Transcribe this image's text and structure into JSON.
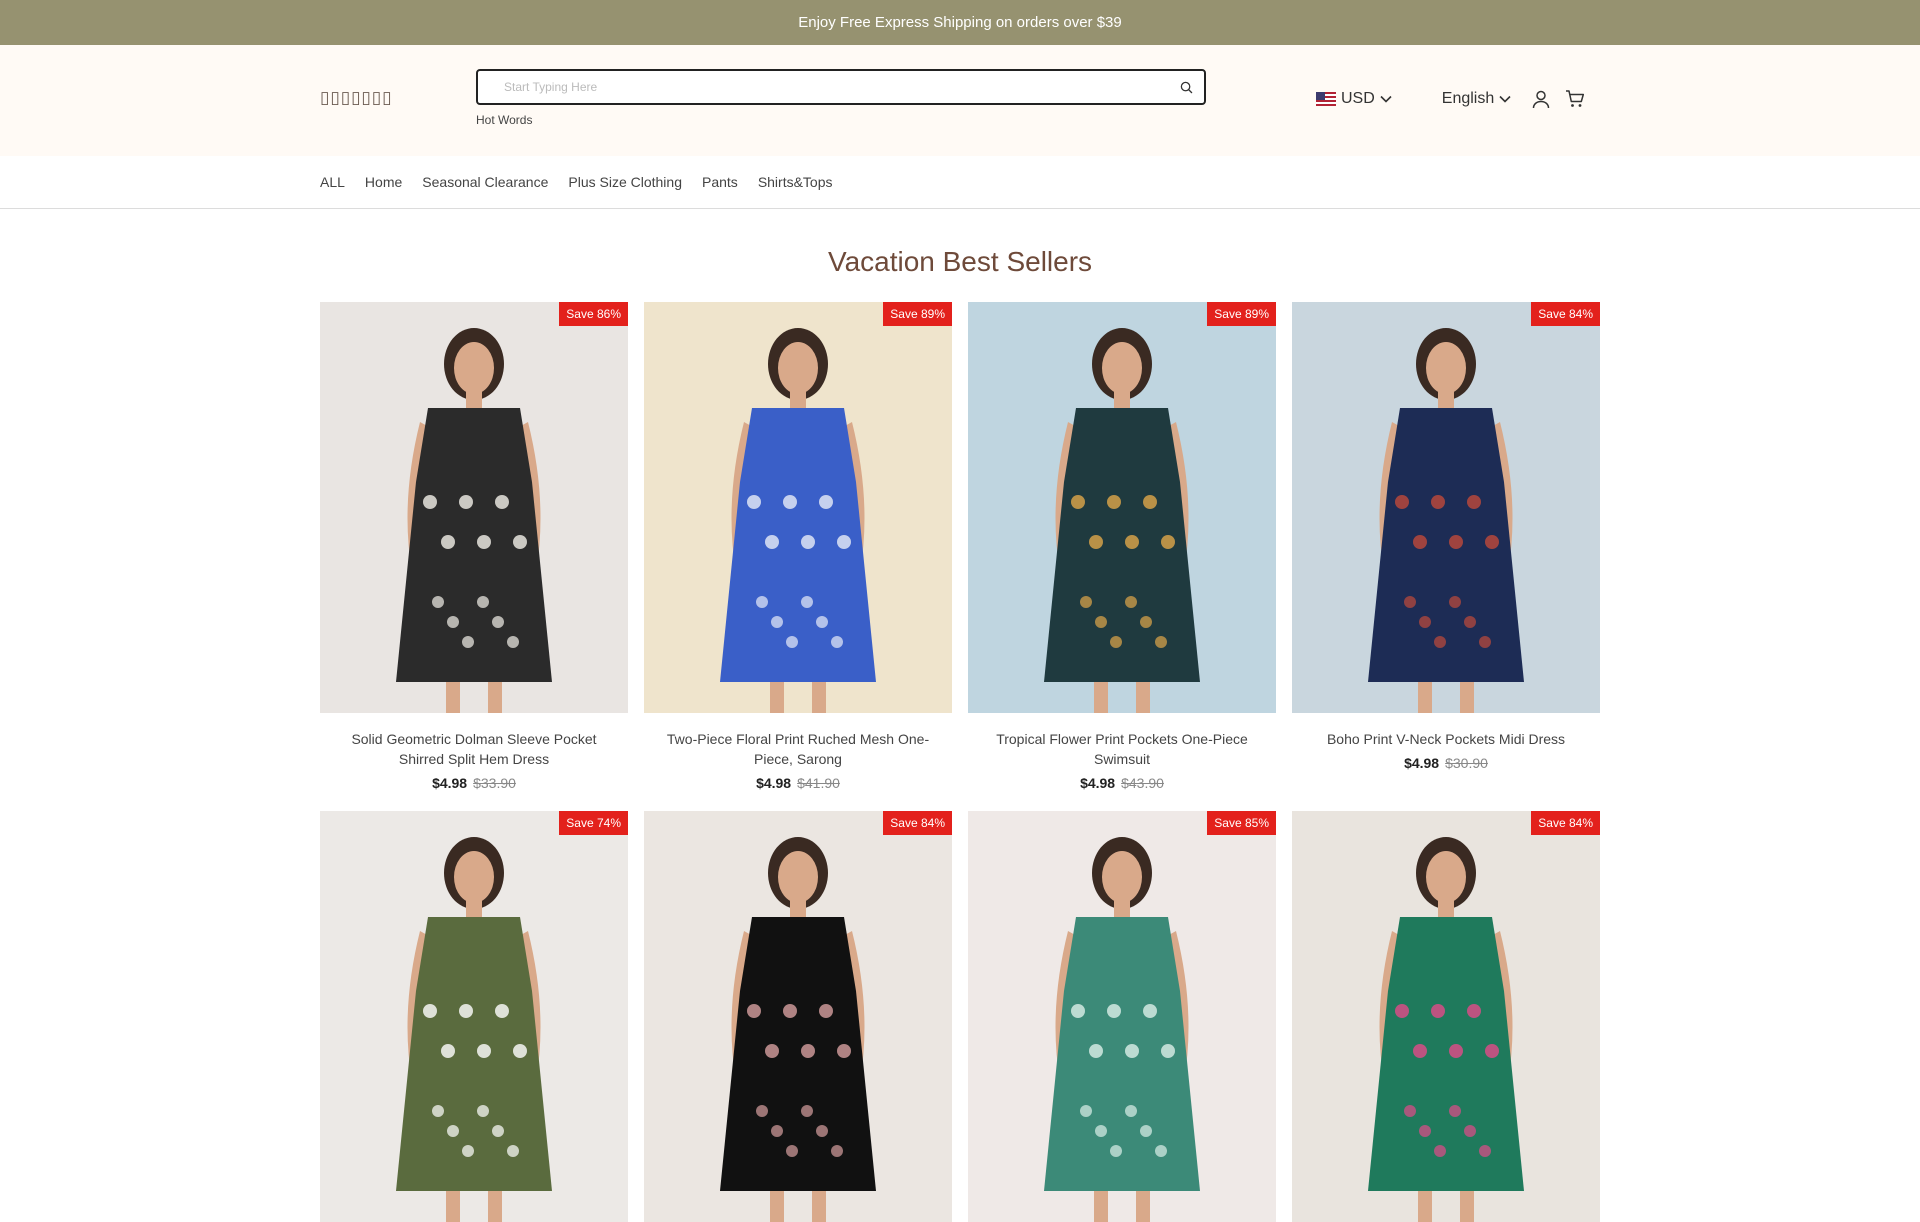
{
  "promo": {
    "text": "Enjoy Free Express Shipping on orders over $39"
  },
  "header": {
    "logo": "▯▯▯▯▯▯▯",
    "search": {
      "placeholder": "Start Typing Here",
      "hot_words": "Hot Words"
    },
    "currency": "USD",
    "language": "English"
  },
  "nav": {
    "items": [
      "ALL",
      "Home",
      "Seasonal Clearance",
      "Plus Size Clothing",
      "Pants",
      "Shirts&Tops"
    ]
  },
  "section": {
    "title": "Vacation Best Sellers"
  },
  "products": [
    {
      "save": "Save 86%",
      "name": "Solid Geometric Dolman Sleeve Pocket Shirred Split Hem Dress",
      "price": "$4.98",
      "old_price": "$33.90",
      "bg": "#e9e5e2",
      "outfit": "#2b2b2b",
      "accent": "#f4f1ea"
    },
    {
      "save": "Save 89%",
      "name": "Two-Piece Floral Print Ruched Mesh One-Piece, Sarong",
      "price": "$4.98",
      "old_price": "$41.90",
      "bg": "#efe4cc",
      "outfit": "#3a5fc8",
      "accent": "#e8ecf8"
    },
    {
      "save": "Save 89%",
      "name": "Tropical Flower Print Pockets One-Piece Swimsuit",
      "price": "$4.98",
      "old_price": "$43.90",
      "bg": "#bfd5e0",
      "outfit": "#1f3a3f",
      "accent": "#e0a74a"
    },
    {
      "save": "Save 84%",
      "name": "Boho Print V-Neck Pockets Midi Dress",
      "price": "$4.98",
      "old_price": "$30.90",
      "bg": "#c9d6de",
      "outfit": "#1d2c55",
      "accent": "#c04a3a"
    },
    {
      "save": "Save 74%",
      "name": "",
      "price": "",
      "old_price": "",
      "bg": "#ece9e6",
      "outfit": "#5a6b3e",
      "accent": "#ffffff"
    },
    {
      "save": "Save 84%",
      "name": "",
      "price": "",
      "old_price": "",
      "bg": "#ebe6e1",
      "outfit": "#111111",
      "accent": "#d7a0a0"
    },
    {
      "save": "Save 85%",
      "name": "",
      "price": "",
      "old_price": "",
      "bg": "#efe9e7",
      "outfit": "#3c8a78",
      "accent": "#dcefe8"
    },
    {
      "save": "Save 84%",
      "name": "",
      "price": "",
      "old_price": "",
      "bg": "#e9e4de",
      "outfit": "#1f7a5c",
      "accent": "#e34a8a"
    }
  ]
}
